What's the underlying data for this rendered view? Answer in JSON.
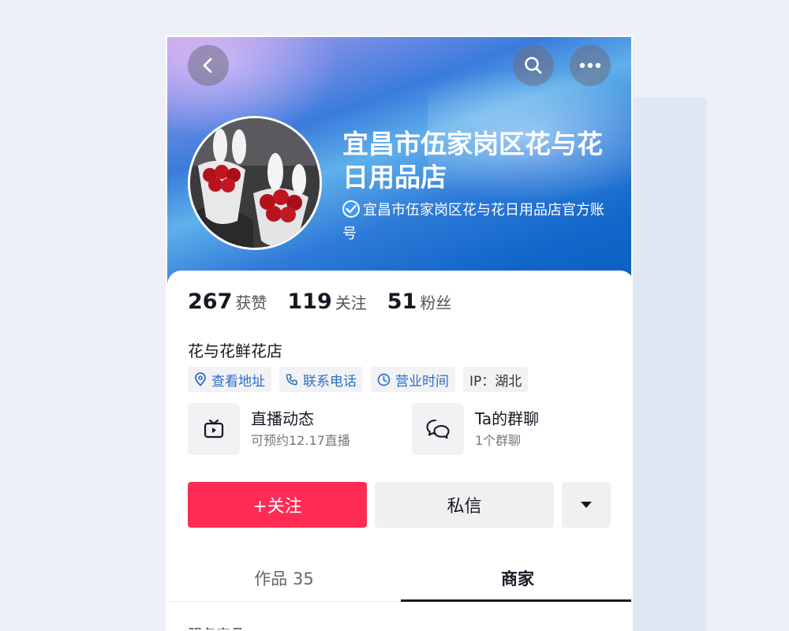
{
  "profile": {
    "shop_name": "宜昌市伍家岗区花与花日用品店",
    "verified_label": "宜昌市伍家岗区花与花日用品店官方账号"
  },
  "stats": {
    "likes": {
      "value": "267",
      "label": "获赞"
    },
    "following": {
      "value": "119",
      "label": "关注"
    },
    "followers": {
      "value": "51",
      "label": "粉丝"
    }
  },
  "bio": "花与花鲜花店",
  "tags": {
    "address": "查看地址",
    "phone": "联系电话",
    "hours": "营业时间",
    "ip": "IP：湖北"
  },
  "features": {
    "live": {
      "title": "直播动态",
      "subtitle": "可预约12.17直播"
    },
    "group": {
      "title": "Ta的群聊",
      "subtitle": "1个群聊"
    }
  },
  "actions": {
    "follow": "+关注",
    "message": "私信"
  },
  "tabs": {
    "works": "作品 35",
    "merchant": "商家"
  },
  "section_peek": "服务商品",
  "colors": {
    "accent": "#fe2c55",
    "link": "#2a6fc9",
    "header_blue": "#0e5fbd"
  },
  "icons": [
    "back-icon",
    "search-icon",
    "more-icon",
    "verified-icon",
    "location-icon",
    "phone-icon",
    "clock-icon",
    "tv-icon",
    "chat-icon",
    "caret-down-icon"
  ]
}
